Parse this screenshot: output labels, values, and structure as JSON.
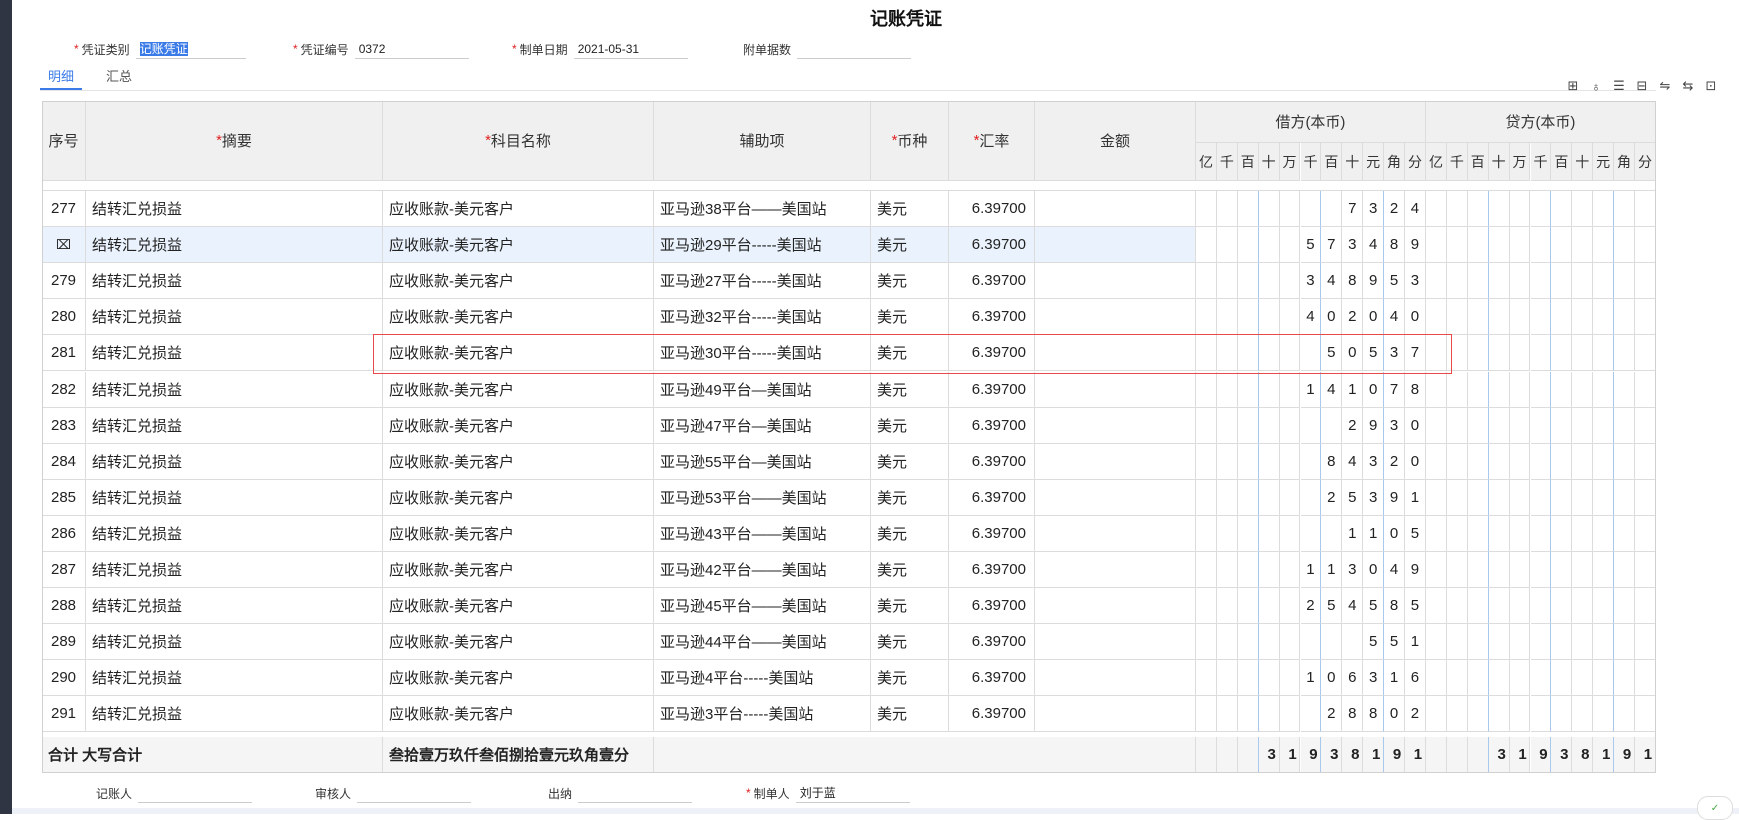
{
  "title": "记账凭证",
  "form": {
    "voucher_type_label": "凭证类别",
    "voucher_type_value": "记账凭证",
    "voucher_no_label": "凭证编号",
    "voucher_no_value": "0372",
    "date_label": "制单日期",
    "date_value": "2021-05-31",
    "attachments_label": "附单据数",
    "attachments_value": ""
  },
  "tabs": [
    "明细",
    "汇总"
  ],
  "toolbar_icons": [
    "insert-row-icon",
    "bag-icon",
    "list-icon",
    "template-icon",
    "link-icon",
    "split-icon",
    "expand-icon"
  ],
  "columns": {
    "seq": "序号",
    "summary": "摘要",
    "account": "科目名称",
    "aux": "辅助项",
    "currency": "币种",
    "rate": "汇率",
    "amount": "金额",
    "debit": "借方(本币)",
    "credit": "贷方(本币)",
    "digits": [
      "亿",
      "千",
      "百",
      "十",
      "万",
      "千",
      "百",
      "十",
      "元",
      "角",
      "分"
    ]
  },
  "rows": [
    {
      "seq": "277",
      "summary": "结转汇兑损益",
      "account": "应收账款-美元客户",
      "aux": "亚马逊38平台——美国站",
      "currency": "美元",
      "rate": "6.39700",
      "amount": "",
      "debit": "7324",
      "credit": ""
    },
    {
      "seq": "",
      "summary": "结转汇兑损益",
      "account": "应收账款-美元客户",
      "aux": "亚马逊29平台-----美国站",
      "currency": "美元",
      "rate": "6.39700",
      "amount": "",
      "debit": "573489",
      "credit": ""
    },
    {
      "seq": "279",
      "summary": "结转汇兑损益",
      "account": "应收账款-美元客户",
      "aux": "亚马逊27平台-----美国站",
      "currency": "美元",
      "rate": "6.39700",
      "amount": "",
      "debit": "348953",
      "credit": ""
    },
    {
      "seq": "280",
      "summary": "结转汇兑损益",
      "account": "应收账款-美元客户",
      "aux": "亚马逊32平台-----美国站",
      "currency": "美元",
      "rate": "6.39700",
      "amount": "",
      "debit": "402040",
      "credit": ""
    },
    {
      "seq": "281",
      "summary": "结转汇兑损益",
      "account": "应收账款-美元客户",
      "aux": "亚马逊30平台-----美国站",
      "currency": "美元",
      "rate": "6.39700",
      "amount": "",
      "debit": "50537",
      "credit": ""
    },
    {
      "seq": "282",
      "summary": "结转汇兑损益",
      "account": "应收账款-美元客户",
      "aux": "亚马逊49平台—美国站",
      "currency": "美元",
      "rate": "6.39700",
      "amount": "",
      "debit": "141078",
      "credit": ""
    },
    {
      "seq": "283",
      "summary": "结转汇兑损益",
      "account": "应收账款-美元客户",
      "aux": "亚马逊47平台—美国站",
      "currency": "美元",
      "rate": "6.39700",
      "amount": "",
      "debit": "2930",
      "credit": ""
    },
    {
      "seq": "284",
      "summary": "结转汇兑损益",
      "account": "应收账款-美元客户",
      "aux": "亚马逊55平台—美国站",
      "currency": "美元",
      "rate": "6.39700",
      "amount": "",
      "debit": "84320",
      "credit": ""
    },
    {
      "seq": "285",
      "summary": "结转汇兑损益",
      "account": "应收账款-美元客户",
      "aux": "亚马逊53平台——美国站",
      "currency": "美元",
      "rate": "6.39700",
      "amount": "",
      "debit": "25391",
      "credit": ""
    },
    {
      "seq": "286",
      "summary": "结转汇兑损益",
      "account": "应收账款-美元客户",
      "aux": "亚马逊43平台——美国站",
      "currency": "美元",
      "rate": "6.39700",
      "amount": "",
      "debit": "1105",
      "credit": ""
    },
    {
      "seq": "287",
      "summary": "结转汇兑损益",
      "account": "应收账款-美元客户",
      "aux": "亚马逊42平台——美国站",
      "currency": "美元",
      "rate": "6.39700",
      "amount": "",
      "debit": "113049",
      "credit": ""
    },
    {
      "seq": "288",
      "summary": "结转汇兑损益",
      "account": "应收账款-美元客户",
      "aux": "亚马逊45平台——美国站",
      "currency": "美元",
      "rate": "6.39700",
      "amount": "",
      "debit": "254585",
      "credit": ""
    },
    {
      "seq": "289",
      "summary": "结转汇兑损益",
      "account": "应收账款-美元客户",
      "aux": "亚马逊44平台——美国站",
      "currency": "美元",
      "rate": "6.39700",
      "amount": "",
      "debit": "551",
      "credit": ""
    },
    {
      "seq": "290",
      "summary": "结转汇兑损益",
      "account": "应收账款-美元客户",
      "aux": "亚马逊4平台-----美国站",
      "currency": "美元",
      "rate": "6.39700",
      "amount": "",
      "debit": "106316",
      "credit": ""
    },
    {
      "seq": "291",
      "summary": "结转汇兑损益",
      "account": "应收账款-美元客户",
      "aux": "亚马逊3平台-----美国站",
      "currency": "美元",
      "rate": "6.39700",
      "amount": "",
      "debit": "28802",
      "credit": ""
    }
  ],
  "totals": {
    "label": "合计 大写合计",
    "words": "叁拾壹万玖仟叁佰捌拾壹元玖角壹分",
    "debit": "31938191",
    "credit": "31938191"
  },
  "footer": {
    "bookkeeper_label": "记账人",
    "auditor_label": "审核人",
    "cashier_label": "出纳",
    "maker_label": "制单人",
    "maker_value": "刘于蓝"
  }
}
